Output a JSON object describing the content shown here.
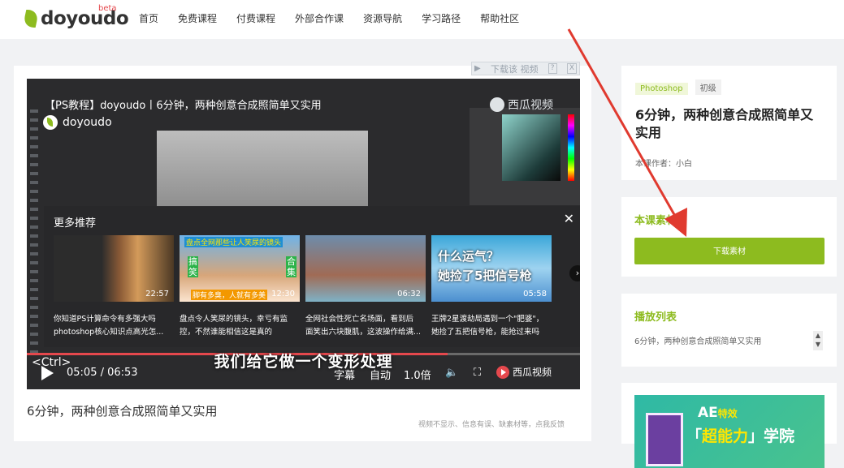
{
  "header": {
    "logo": "doyoudo",
    "beta": "beta",
    "nav": [
      "首页",
      "免费课程",
      "付费课程",
      "外部合作课",
      "资源导航",
      "学习路径",
      "帮助社区"
    ]
  },
  "player": {
    "download_bar": "下载该 视频",
    "download_help": "?",
    "download_close": "X",
    "video_title": "【PS教程】doyoudo丨6分钟，两种创意合成照简单又实用",
    "channel": "doyoudo",
    "watermark": "西瓜视频",
    "overlay_title": "更多推荐",
    "overlay_close": "✕",
    "recommendations": [
      {
        "duration": "22:57",
        "caption1": "你知道PS计算命令有多强大吗",
        "caption2": "photoshop核心知识点高光怎..."
      },
      {
        "duration": "12:30",
        "caption1": "盘点令人笑尿的镜头，幸亏有监",
        "caption2": "控，不然谁能相信这是真的",
        "top": "盘点全网那些让人笑尿的镜头",
        "left": "搞笑",
        "right": "合集",
        "bottom": "脚有多臭，人就有多美"
      },
      {
        "duration": "06:32",
        "caption1": "全网社会性死亡名场面，看到后",
        "caption2": "面笑出六块腹肌，这波操作给满..."
      },
      {
        "duration": "05:58",
        "caption1": "王牌2星渡劫局遇到一个\"肥婆\"，",
        "caption2": "她捡了五把信号枪，能抢过来吗",
        "overlay_line1": "什么运气？",
        "overlay_line2": "她捡了5把信号枪"
      }
    ],
    "next_arrow": "›",
    "subtitle": "我们给它做一个变形处理",
    "ctrl_tag": "<Ctrl>",
    "progress": 0.76,
    "time": "05:05 / 06:53",
    "subtitle_btn": "字幕",
    "quality": "自动",
    "speed": "1.0倍",
    "volume_icon": "volume-icon",
    "fullscreen_icon": "fullscreen-icon",
    "brand": "西瓜视频"
  },
  "main": {
    "video_name": "6分钟，两种创意合成照简单又实用",
    "feedback": "视频不显示、信息有误、缺素材等，点我反馈"
  },
  "sidebar": {
    "tags": [
      "Photoshop",
      "初级"
    ],
    "course_title": "6分钟，两种创意合成照简单又实用",
    "author": "本课作者：小白",
    "material_title": "本课素材",
    "download_button": "下载素材",
    "playlist_title": "播放列表",
    "playlist_item": "6分钟，两种创意合成照简单又实用",
    "banner_line1": "AE",
    "banner_line1b": "特效",
    "banner_line2a": "「",
    "banner_line2b": "超能力",
    "banner_line2c": "」学院"
  },
  "colors": {
    "accent": "#8dbb1f",
    "red": "#e5484d",
    "bg": "#f1f2f4"
  }
}
